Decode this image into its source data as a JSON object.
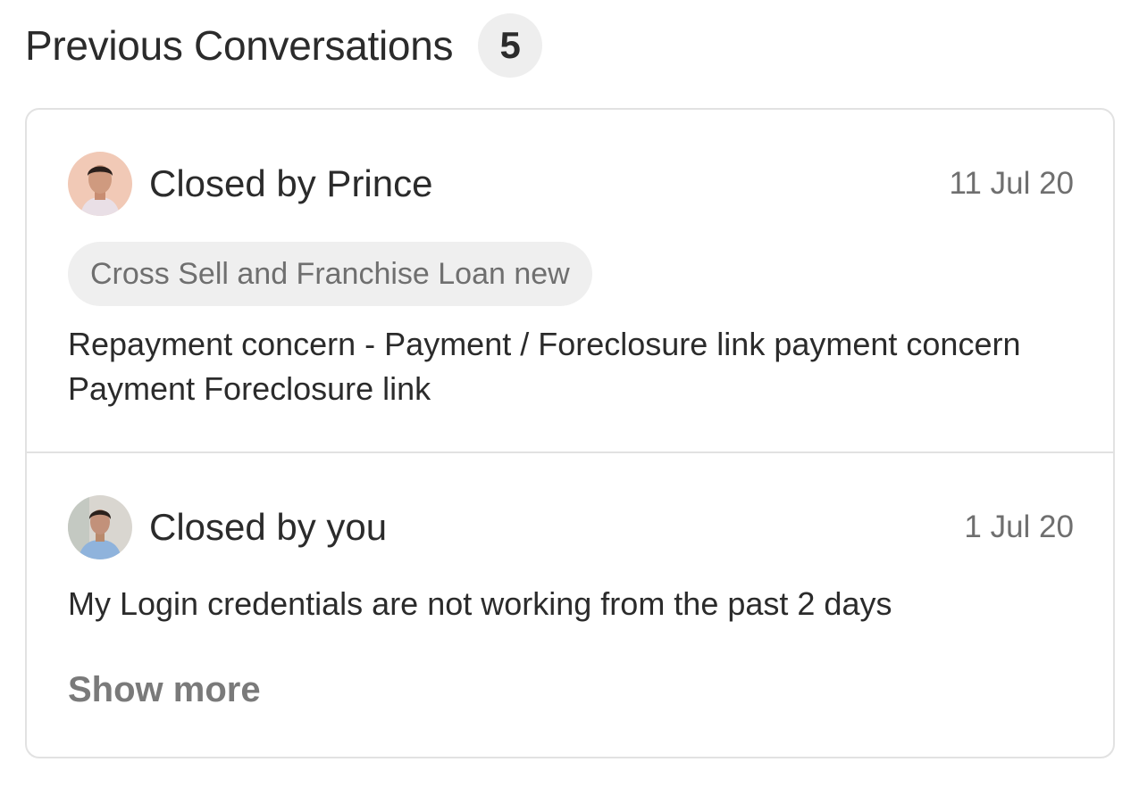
{
  "header": {
    "title": "Previous Conversations",
    "count": "5"
  },
  "conversations": [
    {
      "closed_by": "Closed by Prince",
      "date": "11 Jul 20",
      "tag": "Cross Sell and Franchise Loan new",
      "message": "Repayment concern - Payment / Foreclosure link payment concern Payment Foreclosure link",
      "avatar": "avatar-photo"
    },
    {
      "closed_by": "Closed by you",
      "date": "1 Jul 20",
      "message": "My Login credentials are not working from the past 2 days",
      "avatar": "avatar-photo"
    }
  ],
  "show_more_label": "Show more",
  "colors": {
    "primary_text": "#2b2b2b",
    "secondary_text": "#6f6f6f",
    "badge_bg": "#eeeeee",
    "border": "#e2e2e2"
  }
}
